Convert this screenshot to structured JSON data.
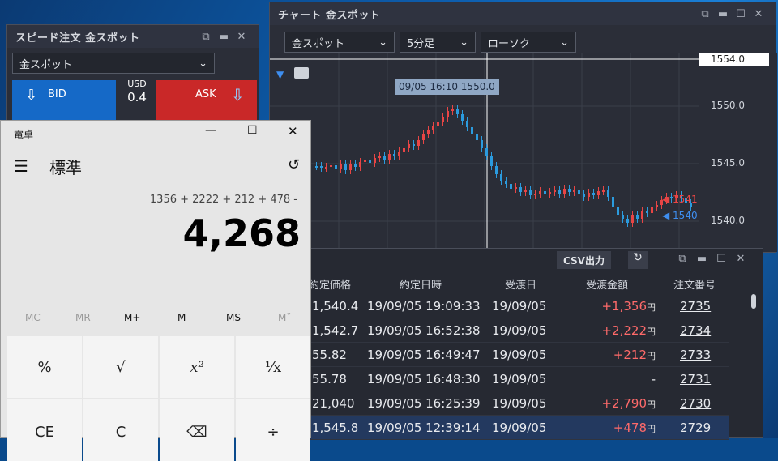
{
  "chart": {
    "title": "チャート 金スポット",
    "symbol": "金スポット",
    "interval": "5分足",
    "style": "ローソク",
    "tooltip": "09/05 16:10 1550.0",
    "price_labels": [
      "1554.0",
      "1550.0",
      "1545.0",
      "1540.0"
    ],
    "ask_marker": "1541",
    "bid_marker": "1540"
  },
  "speed": {
    "title": "スピード注文 金スポット",
    "symbol": "金スポット",
    "bid_label": "BID",
    "ask_label": "ASK",
    "spread_currency": "USD",
    "spread_value": "0.4"
  },
  "table": {
    "csv_button": "CSV出力",
    "columns": [
      "約定価格",
      "約定日時",
      "受渡日",
      "受渡金額",
      "注文番号"
    ],
    "yen": "円",
    "rows": [
      {
        "price": "1,540.4",
        "datetime": "19/09/05 19:09:33",
        "delivery": "19/09/05",
        "amount": "+1,356",
        "yen": "円",
        "order": "2735"
      },
      {
        "price": "1,542.7",
        "datetime": "19/09/05 16:52:38",
        "delivery": "19/09/05",
        "amount": "+2,222",
        "yen": "円",
        "order": "2734"
      },
      {
        "price": "55.82",
        "datetime": "19/09/05 16:49:47",
        "delivery": "19/09/05",
        "amount": "+212",
        "yen": "円",
        "order": "2733"
      },
      {
        "price": "55.78",
        "datetime": "19/09/05 16:48:30",
        "delivery": "19/09/05",
        "amount": "-",
        "yen": "",
        "order": "2731"
      },
      {
        "price": "21,040",
        "datetime": "19/09/05 16:25:39",
        "delivery": "19/09/05",
        "amount": "+2,790",
        "yen": "円",
        "order": "2730"
      },
      {
        "price": "1,545.8",
        "datetime": "19/09/05 12:39:14",
        "delivery": "19/09/05",
        "amount": "+478",
        "yen": "円",
        "order": "2729"
      }
    ]
  },
  "calculator": {
    "title": "電卓",
    "mode": "標準",
    "expression": "1356 + 2222 + 212 + 478 -",
    "display": "4,268",
    "memory": [
      "MC",
      "MR",
      "M+",
      "M-",
      "MS",
      "M˅"
    ],
    "keys": [
      "%",
      "√",
      "x²",
      "¹⁄x",
      "CE",
      "C",
      "⌫",
      "÷"
    ]
  },
  "colors": {
    "bid": "#1569c7",
    "ask": "#c92828",
    "up": "#e84545",
    "down": "#2b9bde"
  }
}
